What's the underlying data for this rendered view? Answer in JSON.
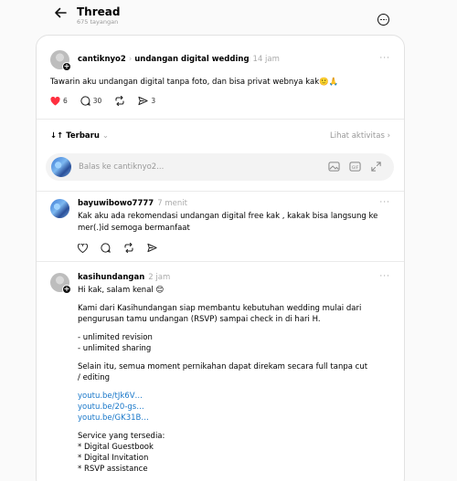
{
  "header": {
    "title": "Thread",
    "views": "675 tayangan"
  },
  "post": {
    "author": "cantiknyo2",
    "community": "undangan digital wedding",
    "time": "14 jam",
    "text": "Tawarin aku undangan digital tanpa foto, dan bisa privat webnya kak🙂🙏",
    "likes": "6",
    "comments": "30",
    "shares": "3"
  },
  "sort": {
    "label": "Terbaru",
    "activity_link": "Lihat aktivitas"
  },
  "reply": {
    "placeholder": "Balas ke cantiknyo2..."
  },
  "comments": [
    {
      "author": "bayuwibowo7777",
      "time": "7 menit",
      "lines": [
        "Kak aku ada rekomendasi undangan digital free kak , kakak bisa langsung ke",
        "mer(.)id semoga bermanfaat"
      ]
    },
    {
      "author": "kasihundangan",
      "time": "2 jam",
      "lines": [
        "Hi kak, salam kenal 😊",
        "Kami dari Kasihundangan siap membantu kebutuhan wedding mulai dari",
        "pengurusan tamu undangan (RSVP) sampai check in di hari H.",
        "- unlimited revision",
        "- unlimited sharing",
        "Selain itu, semua moment pernikahan dapat direkam secara full tanpa cut",
        "/ editing",
        "youtu.be/tJk6V…",
        "youtu.be/20-gs…",
        "youtu.be/GK31B…",
        "Service yang tersedia:",
        "* Digital Guestbook",
        "* Digital Invitation",
        "* RSVP assistance"
      ]
    }
  ],
  "colors": {
    "like": "#ff3040",
    "link": "#1877c9",
    "muted": "#999999"
  }
}
